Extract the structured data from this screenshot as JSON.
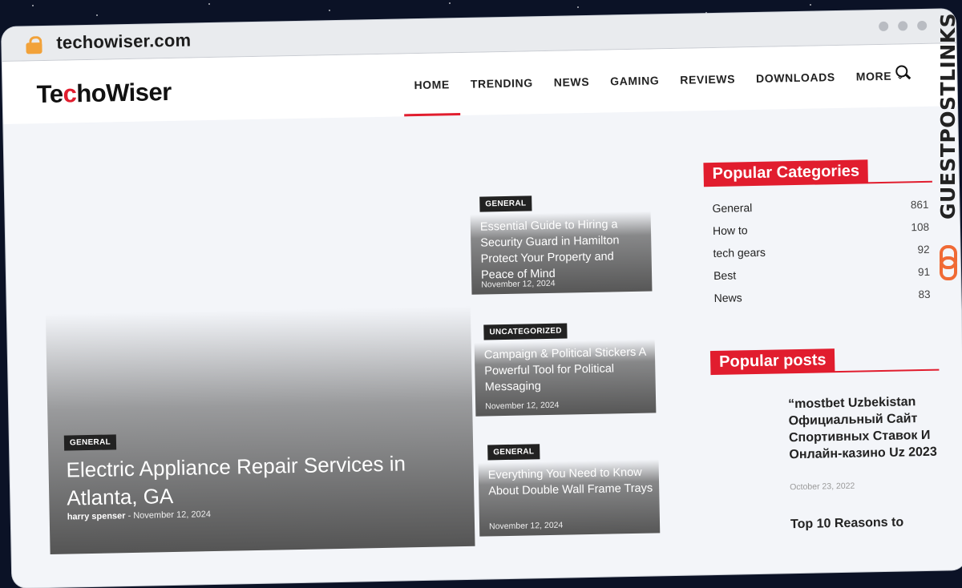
{
  "browser": {
    "url": "techowiser.com"
  },
  "site": {
    "logo_before": "Te",
    "logo_accent": "c",
    "logo_after": "hoWiser",
    "nav": [
      {
        "label": "HOME",
        "active": true
      },
      {
        "label": "TRENDING"
      },
      {
        "label": "NEWS"
      },
      {
        "label": "GAMING"
      },
      {
        "label": "REVIEWS"
      },
      {
        "label": "DOWNLOADS"
      },
      {
        "label": "MORE"
      }
    ]
  },
  "hero": {
    "tag": "GENERAL",
    "title": "Electric Appliance Repair Services in Atlanta, GA",
    "author": "harry spenser",
    "separator": "-",
    "date": "November 12, 2024"
  },
  "cards": [
    {
      "tag": "GENERAL",
      "title": "Essential Guide to Hiring a Security Guard in Hamilton Protect Your Property and Peace of Mind",
      "date": "November 12, 2024"
    },
    {
      "tag": "UNCATEGORIZED",
      "title": "Campaign & Political Stickers A Powerful Tool for Political Messaging",
      "date": "November 12, 2024"
    },
    {
      "tag": "GENERAL",
      "title": "Everything You Need to Know About Double Wall Frame Trays",
      "date": "November 12, 2024"
    }
  ],
  "sidebar": {
    "categories_heading": "Popular Categories",
    "categories": [
      {
        "name": "General",
        "count": "861"
      },
      {
        "name": "How to",
        "count": "108"
      },
      {
        "name": "tech gears",
        "count": "92"
      },
      {
        "name": "Best",
        "count": "91"
      },
      {
        "name": "News",
        "count": "83"
      }
    ],
    "posts_heading": "Popular posts",
    "posts": [
      {
        "title": "“mostbet Uzbekistan Официальный Сайт Спортивных Ставок И Онлайн-казино Uz 2023",
        "date": "October 23, 2022"
      },
      {
        "title": "Top 10 Reasons to",
        "date": ""
      }
    ]
  },
  "watermark": {
    "text": "GUESTPOSTLINKS"
  }
}
